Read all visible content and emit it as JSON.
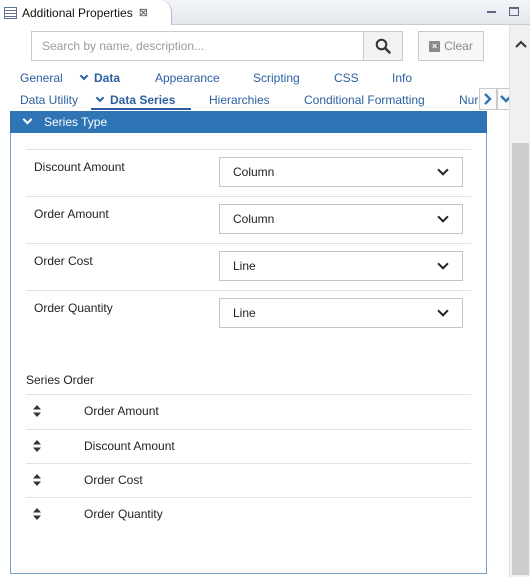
{
  "window": {
    "title": "Additional Properties",
    "close_glyph": "⊠"
  },
  "search": {
    "placeholder": "Search by name, description...",
    "value": "",
    "clear_label": "Clear"
  },
  "primary_tabs": [
    {
      "label": "General",
      "active": false
    },
    {
      "label": "Data",
      "active": true
    },
    {
      "label": "Appearance",
      "active": false
    },
    {
      "label": "Scripting",
      "active": false
    },
    {
      "label": "CSS",
      "active": false
    },
    {
      "label": "Info",
      "active": false
    }
  ],
  "secondary_tabs": [
    {
      "label": "Data Utility",
      "active": false
    },
    {
      "label": "Data Series",
      "active": true
    },
    {
      "label": "Hierarchies",
      "active": false
    },
    {
      "label": "Conditional Formatting",
      "active": false
    },
    {
      "label": "Nur",
      "active": false
    }
  ],
  "series_type": {
    "header": "Series Type",
    "rows": [
      {
        "label": "Discount Amount",
        "value": "Column"
      },
      {
        "label": "Order Amount",
        "value": "Column"
      },
      {
        "label": "Order Cost",
        "value": "Line"
      },
      {
        "label": "Order Quantity",
        "value": "Line"
      }
    ]
  },
  "series_order": {
    "title": "Series Order",
    "items": [
      "Order Amount",
      "Discount Amount",
      "Order Cost",
      "Order Quantity"
    ]
  },
  "colors": {
    "accent": "#2f74b5",
    "link": "#2a5fa0"
  },
  "icons": {
    "search": "search-icon",
    "clear": "clear-icon",
    "drag": "sort-handle-icon",
    "tab_next": "chevron-right-icon",
    "tab_menu": "chevron-down-icon"
  }
}
